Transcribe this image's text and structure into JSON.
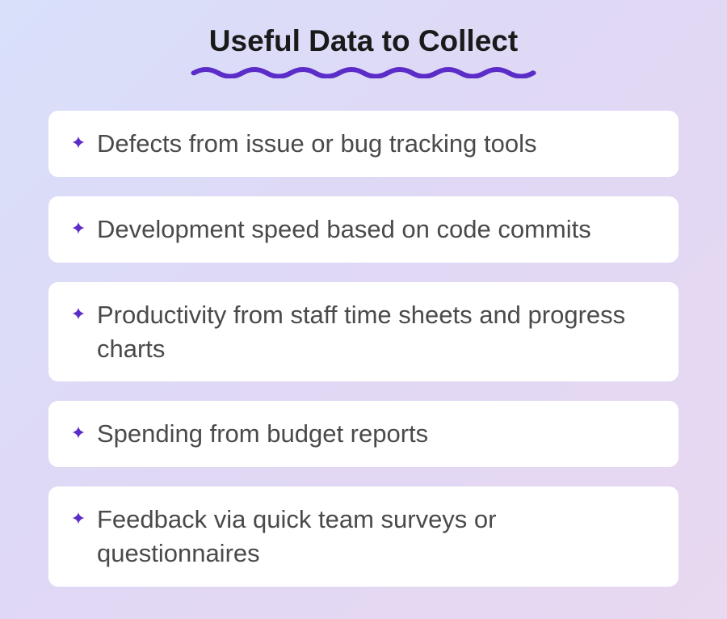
{
  "heading": "Useful Data to Collect",
  "items": [
    "Defects from issue or bug tracking tools",
    "Development speed based on code commits",
    "Productivity from staff time sheets and progress charts",
    "Spending from budget reports",
    "Feedback via quick team surveys or questionnaires"
  ],
  "colors": {
    "accent": "#5b2cc7"
  }
}
